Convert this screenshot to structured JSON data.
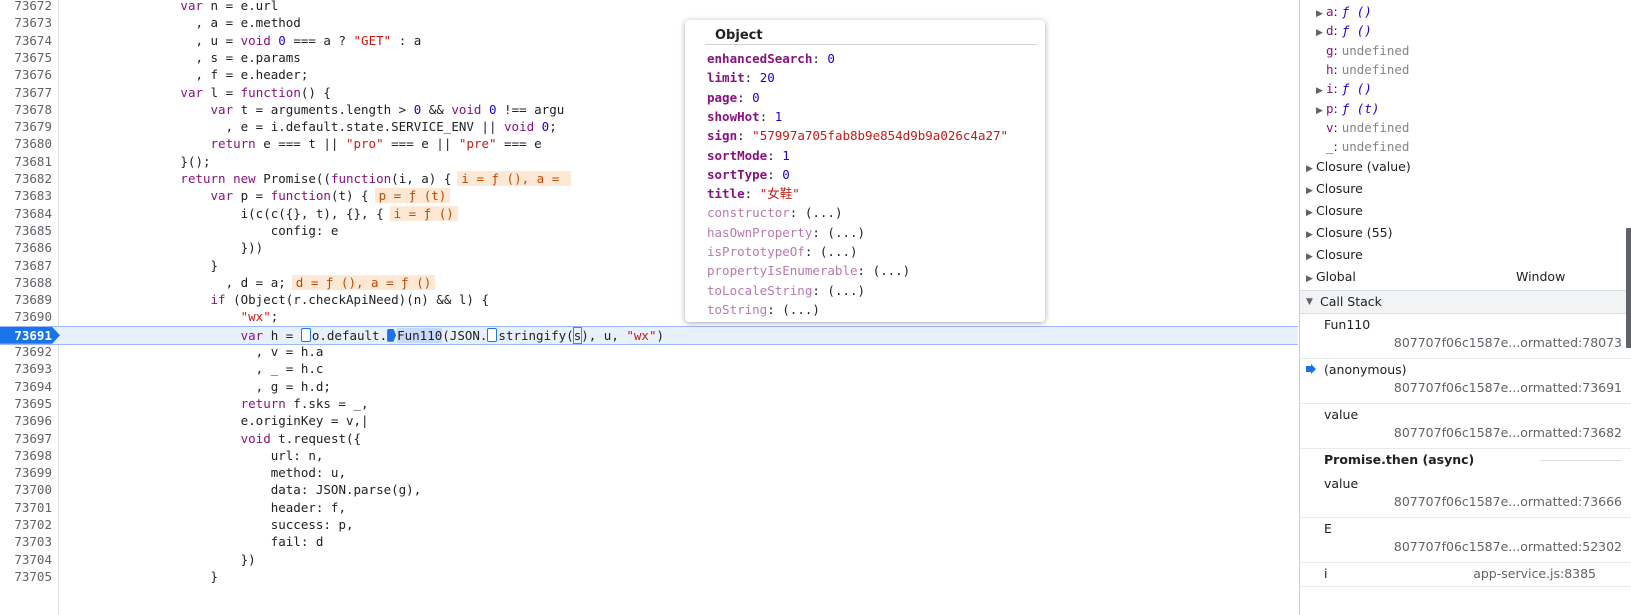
{
  "editor": {
    "lines": [
      {
        "n": "73672",
        "html": "                <span class=\"kw\">var</span> n = e.url"
      },
      {
        "n": "73673",
        "html": "                  , a = e.method"
      },
      {
        "n": "73674",
        "html": "                  , u = <span class=\"kw\">void</span> <span class=\"num\">0</span> === a ? <span class=\"str\">\"GET\"</span> : a"
      },
      {
        "n": "73675",
        "html": "                  , s = e.params"
      },
      {
        "n": "73676",
        "html": "                  , f = e.header;"
      },
      {
        "n": "73677",
        "html": "                <span class=\"kw\">var</span> l = <span class=\"kw\">function</span>() {"
      },
      {
        "n": "73678",
        "html": "                    <span class=\"kw\">var</span> t = arguments.length > <span class=\"num\">0</span> &amp;&amp; <span class=\"kw\">void</span> <span class=\"num\">0</span> !== argu"
      },
      {
        "n": "73679",
        "html": "                      , e = i.default.state.SERVICE_ENV || <span class=\"kw\">void</span> <span class=\"num\">0</span>;"
      },
      {
        "n": "73680",
        "html": "                    <span class=\"kw\">return</span> e === t || <span class=\"str\">\"pro\"</span> === e || <span class=\"str\">\"pre\"</span> === e"
      },
      {
        "n": "73681",
        "html": "                }();"
      },
      {
        "n": "73682",
        "html": "                <span class=\"kw\">return</span> <span class=\"kw\">new</span> Promise((<span class=\"kw\">function</span>(i, a) {<span class=\"inline-val\">i = ƒ (), a = </span>"
      },
      {
        "n": "73683",
        "html": "                    <span class=\"kw\">var</span> p = <span class=\"kw\">function</span>(t) {<span class=\"inline-val\">p = ƒ (t)</span>"
      },
      {
        "n": "73684",
        "html": "                        i(c(c({}, t), {}, {<span class=\"inline-val\">i = ƒ ()</span>"
      },
      {
        "n": "73685",
        "html": "                            config: e"
      },
      {
        "n": "73686",
        "html": "                        }))"
      },
      {
        "n": "73687",
        "html": "                    }"
      },
      {
        "n": "73688",
        "html": "                      , d = a;<span class=\"inline-val\">d = ƒ (), a = ƒ ()</span>"
      },
      {
        "n": "73689",
        "html": "                    <span class=\"kw\">if</span> (Object(r.checkApiNeed)(n) &amp;&amp; l) {"
      },
      {
        "n": "73690",
        "html": "                        <span class=\"str\">\"wx\"</span>;"
      },
      {
        "n": "73691",
        "html": "                        <span class=\"kw\">var</span> h = <span class=\"step-mark\"></span>o.default.<span class=\"step-mark filled\"></span><span class=\"hl-fn\">Fun110</span>(JSON.<span class=\"step-mark\"></span>stringify(<span class=\"cursor-box\">s</span>), u, <span class=\"str\">\"wx\"</span>)",
        "active": true
      },
      {
        "n": "73692",
        "html": "                          , v = h.a"
      },
      {
        "n": "73693",
        "html": "                          , _ = h.c"
      },
      {
        "n": "73694",
        "html": "                          , g = h.d;"
      },
      {
        "n": "73695",
        "html": "                        <span class=\"kw\">return</span> f.sks = _,"
      },
      {
        "n": "73696",
        "html": "                        e.originKey = v,|"
      },
      {
        "n": "73697",
        "html": "                        <span class=\"kw\">void</span> t.request({"
      },
      {
        "n": "73698",
        "html": "                            url: n,"
      },
      {
        "n": "73699",
        "html": "                            method: u,"
      },
      {
        "n": "73700",
        "html": "                            data: JSON.parse(g),"
      },
      {
        "n": "73701",
        "html": "                            header: f,"
      },
      {
        "n": "73702",
        "html": "                            success: p,"
      },
      {
        "n": "73703",
        "html": "                            fail: d"
      },
      {
        "n": "73704",
        "html": "                        })"
      },
      {
        "n": "73705",
        "html": "                    }"
      }
    ]
  },
  "popover": {
    "title": "Object",
    "props": [
      {
        "name": "enhancedSearch",
        "value": "0",
        "type": "num"
      },
      {
        "name": "limit",
        "value": "20",
        "type": "num"
      },
      {
        "name": "page",
        "value": "0",
        "type": "num"
      },
      {
        "name": "showHot",
        "value": "1",
        "type": "num"
      },
      {
        "name": "sign",
        "value": "\"57997a705fab8b9e854d9b9a026c4a27\"",
        "type": "str"
      },
      {
        "name": "sortMode",
        "value": "1",
        "type": "num"
      },
      {
        "name": "sortType",
        "value": "0",
        "type": "num"
      },
      {
        "name": "title",
        "value": "\"女鞋\"",
        "type": "str"
      },
      {
        "name": "constructor",
        "value": "(...)",
        "type": "plain",
        "dim": true
      },
      {
        "name": "hasOwnProperty",
        "value": "(...)",
        "type": "plain",
        "dim": true
      },
      {
        "name": "isPrototypeOf",
        "value": "(...)",
        "type": "plain",
        "dim": true
      },
      {
        "name": "propertyIsEnumerable",
        "value": "(...)",
        "type": "plain",
        "dim": true
      },
      {
        "name": "toLocaleString",
        "value": "(...)",
        "type": "plain",
        "dim": true
      },
      {
        "name": "toString",
        "value": "(...)",
        "type": "plain",
        "dim": true
      }
    ]
  },
  "scope": {
    "vars": [
      {
        "name": "a",
        "value": "ƒ ()",
        "expandable": true,
        "kind": "fn"
      },
      {
        "name": "d",
        "value": "ƒ ()",
        "expandable": true,
        "kind": "fn"
      },
      {
        "name": "g",
        "value": "undefined",
        "expandable": false,
        "kind": "undef"
      },
      {
        "name": "h",
        "value": "undefined",
        "expandable": false,
        "kind": "undef"
      },
      {
        "name": "i",
        "value": "ƒ ()",
        "expandable": true,
        "kind": "fn"
      },
      {
        "name": "p",
        "value": "ƒ (t)",
        "expandable": true,
        "kind": "fn"
      },
      {
        "name": "v",
        "value": "undefined",
        "expandable": false,
        "kind": "undef"
      },
      {
        "name": "_",
        "value": "undefined",
        "expandable": false,
        "kind": "undef"
      }
    ],
    "closures": [
      "Closure (value)",
      "Closure",
      "Closure",
      "Closure (55)",
      "Closure"
    ],
    "global_label": "Global",
    "global_value": "Window"
  },
  "call_stack": {
    "header": "Call Stack",
    "frames": [
      {
        "name": "Fun110",
        "loc": "807707f06c1587e...ormatted:78073",
        "current": false
      },
      {
        "name": "(anonymous)",
        "loc": "807707f06c1587e...ormatted:73691",
        "current": true
      },
      {
        "name": "value",
        "loc": "807707f06c1587e...ormatted:73682",
        "current": false
      }
    ],
    "async_label": "Promise.then (async)",
    "frames_after": [
      {
        "name": "value",
        "loc": "807707f06c1587e...ormatted:73666"
      },
      {
        "name": "E",
        "loc": "807707f06c1587e...ormatted:52302"
      }
    ],
    "last": {
      "name": "i",
      "loc": "app-service.js:8385"
    }
  }
}
